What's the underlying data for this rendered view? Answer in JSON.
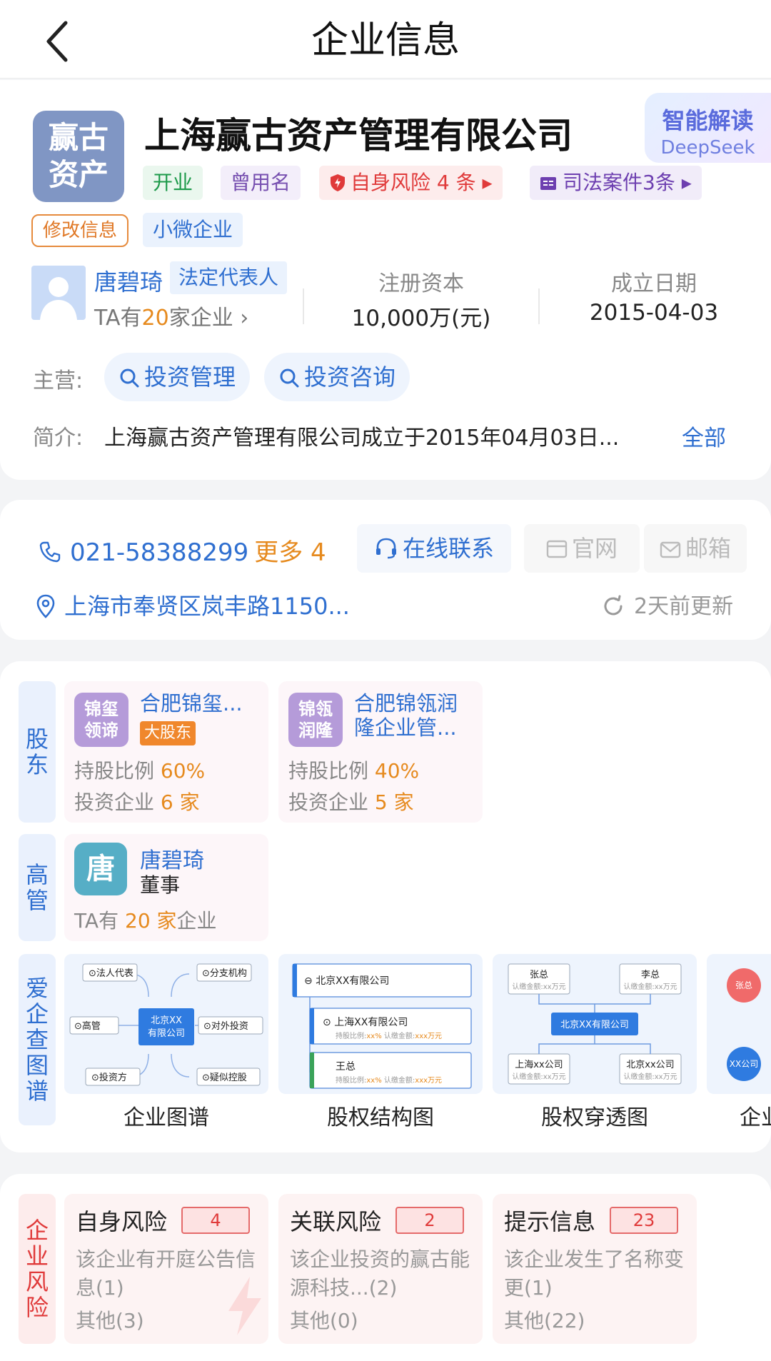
{
  "header": {
    "title": "企业信息"
  },
  "company": {
    "logo_line1": "赢古",
    "logo_line2": "资产",
    "name": "上海赢古资产管理有限公司",
    "ai_title": "智能解读",
    "ai_sub": "DeepSeek",
    "tags": {
      "status": "开业",
      "former_name": "曾用名",
      "risk": "自身风险 4 条 ▸",
      "judicial": "司法案件3条 ▸",
      "edit": "修改信息",
      "size": "小微企业"
    },
    "legal_rep": {
      "name": "唐碧琦",
      "role": "法定代表人",
      "count_prefix": "TA有",
      "count": "20",
      "count_suffix": "家企业 ›"
    },
    "capital": {
      "label": "注册资本",
      "value": "10,000万(元)"
    },
    "founded": {
      "label": "成立日期",
      "value": "2015-04-03"
    },
    "business_label": "主营:",
    "business": [
      "投资管理",
      "投资咨询"
    ],
    "intro_label": "简介:",
    "intro": "上海赢古资产管理有限公司成立于2015年04月03日...",
    "intro_all": "全部"
  },
  "contact": {
    "phone": "021-58388299",
    "more": "更多 4",
    "online": "在线联系",
    "website": "官网",
    "email": "邮箱",
    "address": "上海市奉贤区岚丰路1150...",
    "updated": "2天前更新"
  },
  "shareholders": {
    "label": "股东",
    "items": [
      {
        "logo": "锦玺领谛",
        "logo1": "锦玺",
        "logo2": "领谛",
        "name": "合肥锦玺...",
        "badge": "大股东",
        "ratio_label": "持股比例 ",
        "ratio": "60%",
        "invest_label": "投资企业 ",
        "invest": "6 家"
      },
      {
        "logo1": "锦瓴",
        "logo2": "润隆",
        "name": "合肥锦瓴润隆企业管...",
        "ratio_label": "持股比例 ",
        "ratio": "40%",
        "invest_label": "投资企业 ",
        "invest": "5 家"
      }
    ]
  },
  "executives": {
    "label": "高管",
    "items": [
      {
        "logo": "唐",
        "name": "唐碧琦",
        "role": "董事",
        "count_prefix": "TA有 ",
        "count": "20 家",
        "count_suffix": "企业"
      }
    ]
  },
  "graphs": {
    "label": "爱企查图谱",
    "items": [
      {
        "label": "企业图谱",
        "center": "北京XX\n有限公司",
        "nodes": [
          "法人代表",
          "分支机构",
          "高管",
          "对外投资",
          "投资方",
          "疑似控股"
        ]
      },
      {
        "label": "股权结构图",
        "root": "北京XX有限公司",
        "child1": "上海XX有限公司",
        "child2": "王总",
        "meta_ratio": "持股比例:",
        "meta_ratio_val": "xx%",
        "meta_amount": "认缴金额:",
        "meta_amount_val": "xxx万元"
      },
      {
        "label": "股权穿透图",
        "top1": "张总",
        "top2": "李总",
        "center": "北京XX有限公司",
        "bottom1": "上海xx公司",
        "bottom2": "北京xx公司",
        "meta": "认缴金额:xx万元"
      },
      {
        "label": "企业",
        "n1": "张总",
        "n2": "XX公司"
      }
    ]
  },
  "risks": {
    "label": "企业风险",
    "items": [
      {
        "title": "自身风险",
        "count": "4",
        "desc": "该企业有开庭公告信息(1)",
        "other": "其他(3)"
      },
      {
        "title": "关联风险",
        "count": "2",
        "desc": "该企业投资的赢古能源科技...(2)",
        "other": "其他(0)"
      },
      {
        "title": "提示信息",
        "count": "23",
        "desc": "该企业发生了名称变更(1)",
        "other": "其他(22)"
      }
    ]
  },
  "colors": {
    "accent": "#2f6fd0",
    "orange": "#e68a1e",
    "danger": "#e03a3a"
  }
}
